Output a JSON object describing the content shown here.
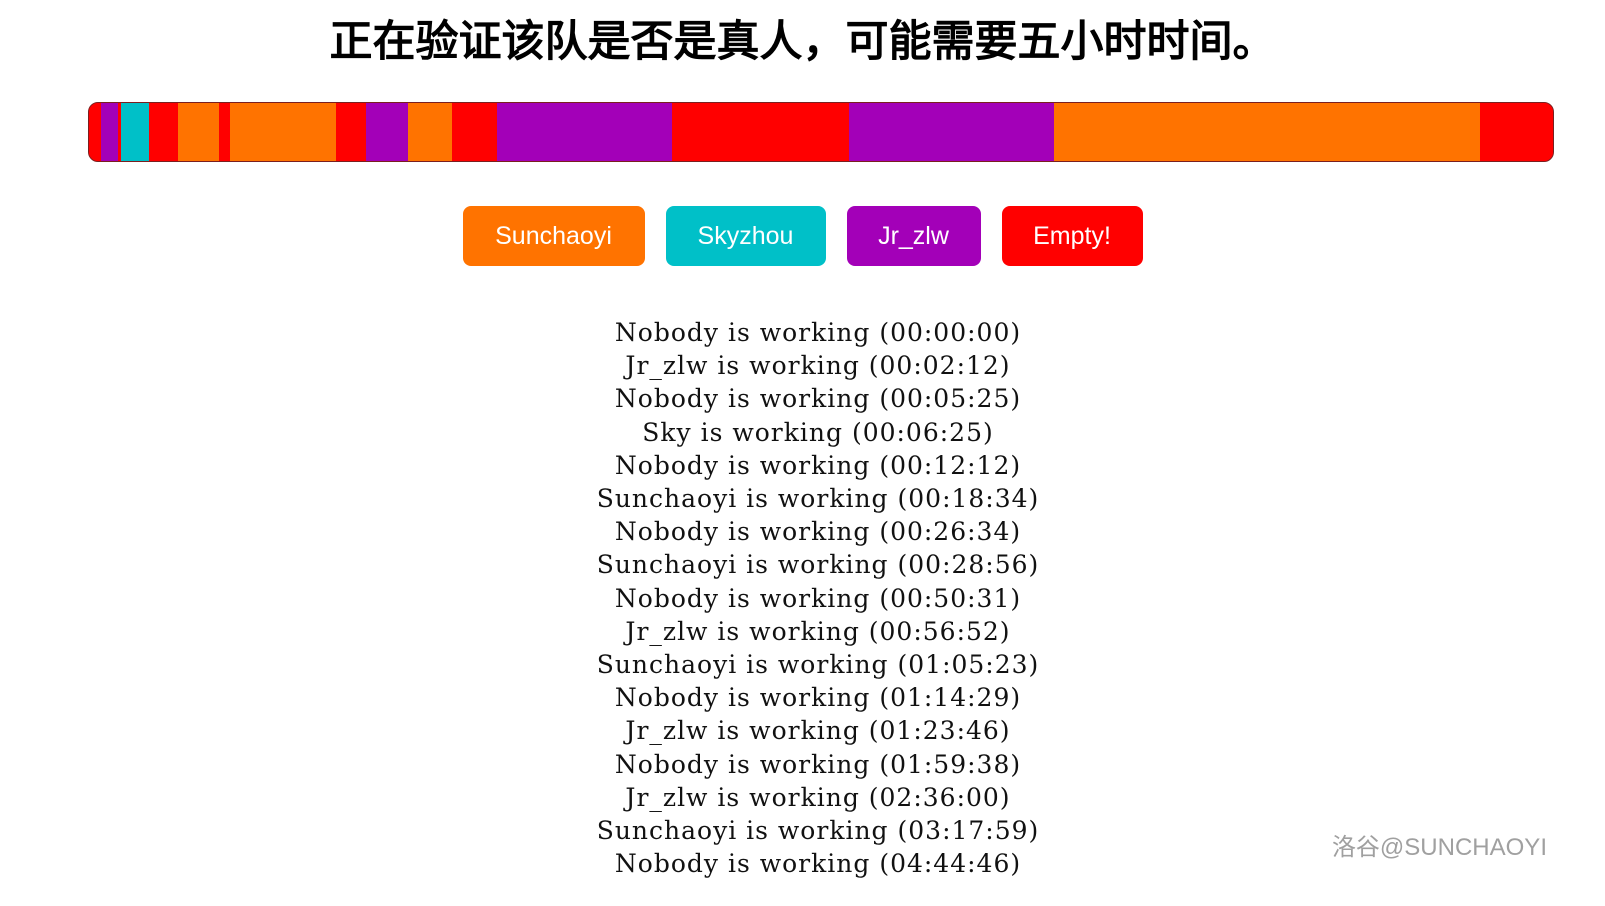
{
  "title": "正在验证该队是否是真人，可能需要五小时时间。",
  "colors": {
    "sunchaoyi": "#ff7300",
    "skyzhou": "#00c0c8",
    "jr_zlw": "#a300b8",
    "empty": "#ff0000"
  },
  "timeline": {
    "segments": [
      {
        "who": "empty",
        "from": 0,
        "to": 0.008
      },
      {
        "who": "jr_zlw",
        "from": 0.008,
        "to": 0.02
      },
      {
        "who": "empty",
        "from": 0.02,
        "to": 0.022
      },
      {
        "who": "skyzhou",
        "from": 0.022,
        "to": 0.041
      },
      {
        "who": "empty",
        "from": 0.041,
        "to": 0.061
      },
      {
        "who": "sunchaoyi",
        "from": 0.061,
        "to": 0.089
      },
      {
        "who": "empty",
        "from": 0.089,
        "to": 0.096
      },
      {
        "who": "sunchaoyi",
        "from": 0.096,
        "to": 0.169
      },
      {
        "who": "empty",
        "from": 0.169,
        "to": 0.189
      },
      {
        "who": "jr_zlw",
        "from": 0.189,
        "to": 0.218
      },
      {
        "who": "sunchaoyi",
        "from": 0.218,
        "to": 0.248
      },
      {
        "who": "empty",
        "from": 0.248,
        "to": 0.279
      },
      {
        "who": "jr_zlw",
        "from": 0.279,
        "to": 0.398
      },
      {
        "who": "empty",
        "from": 0.398,
        "to": 0.519
      },
      {
        "who": "jr_zlw",
        "from": 0.519,
        "to": 0.659
      },
      {
        "who": "sunchaoyi",
        "from": 0.659,
        "to": 0.95
      },
      {
        "who": "empty",
        "from": 0.95,
        "to": 1.0
      }
    ]
  },
  "buttons": [
    {
      "label": "Sunchaoyi",
      "color": "#ff7300",
      "name": "sunchaoyi-button"
    },
    {
      "label": "Skyzhou",
      "color": "#00c0c8",
      "name": "skyzhou-button"
    },
    {
      "label": "Jr_zlw",
      "color": "#a300b8",
      "name": "jr-zlw-button"
    },
    {
      "label": "Empty!",
      "color": "#ff0000",
      "name": "empty-button"
    }
  ],
  "log": [
    "Nobody is working (00:00:00)",
    "Jr_zlw is working (00:02:12)",
    "Nobody is working (00:05:25)",
    "Sky is working (00:06:25)",
    "Nobody is working (00:12:12)",
    "Sunchaoyi is working (00:18:34)",
    "Nobody is working (00:26:34)",
    "Sunchaoyi is working (00:28:56)",
    "Nobody is working (00:50:31)",
    "Jr_zlw is working (00:56:52)",
    "Sunchaoyi is working (01:05:23)",
    "Nobody is working (01:14:29)",
    "Jr_zlw is working (01:23:46)",
    "Nobody is working (01:59:38)",
    "Jr_zlw is working (02:36:00)",
    "Sunchaoyi is working (03:17:59)",
    "Nobody is working (04:44:46)"
  ],
  "watermark": "洛谷@SUNCHAOYI"
}
